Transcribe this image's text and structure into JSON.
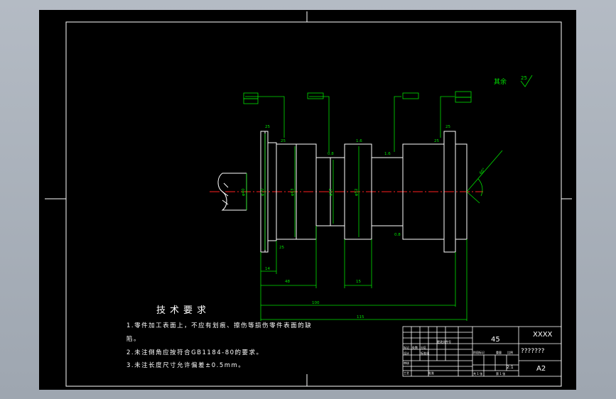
{
  "drawing": {
    "tech_requirements": {
      "title": "技术要求",
      "items": [
        "1.零件加工表面上，不应有划痕、擦伤等损伤零件表面的缺",
        "陷。",
        "2.未注倒角应按符合GB1184-80的要求。",
        "3.未注长度尺寸允许偏差±0.5mm。"
      ]
    },
    "roughness_note": {
      "label": "其余",
      "value": "25"
    },
    "dimensions": {
      "horizontal": [
        "14",
        "48",
        "15",
        "100",
        "115"
      ],
      "diameters": [
        "φ40",
        "φ70",
        "φ63",
        "φ57",
        "φ52"
      ],
      "roughness": [
        "25",
        "25",
        "0.8",
        "1.6",
        "1.6",
        "0.8",
        "25",
        "25",
        "25"
      ],
      "chamfer_angle": "60°"
    },
    "title_block": {
      "material": "45",
      "part_name": "XXXX",
      "drawing_number": "???????",
      "sheet_size": "A2",
      "scale": "2:1"
    },
    "colors": {
      "background": "#000000",
      "outline": "#ffffff",
      "dimension": "#00ff00",
      "centerline": "#ff0000",
      "frame": "#ffffff"
    }
  }
}
